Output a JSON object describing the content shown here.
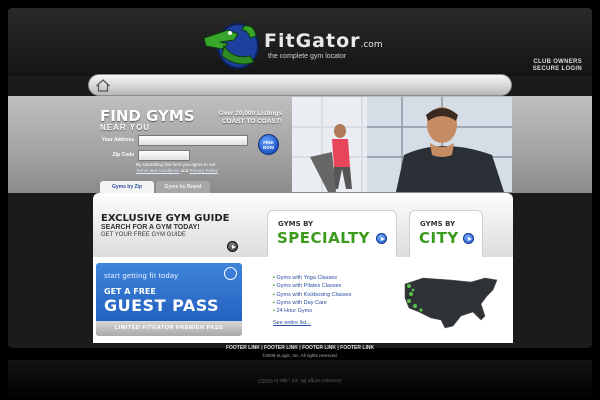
{
  "brand": {
    "name": "FitGator",
    "dotcom": ".com",
    "tagline": "the complete gym locator"
  },
  "header": {
    "club_owners": "CLUB OWNERS",
    "secure_login": "SECURE LOGIN"
  },
  "find": {
    "title": "FIND GYMS",
    "subtitle": "NEAR YOU",
    "listings_line1": "Over 20,000 Listings",
    "listings_line2": "COAST TO COAST!",
    "address_label": "Your Address",
    "address_value": "",
    "zip_label": "Zip Code",
    "zip_value": "",
    "button_line1": "FIND",
    "button_line2": "NOW",
    "disclaimer_pre": "By submitting this form you agree to our",
    "terms_link": "Terms and Conditions",
    "and": "and",
    "privacy_link": "Privacy Policy",
    "tabs": [
      "Gyms by Zip",
      "Gyms by Brand"
    ]
  },
  "exclusive": {
    "title": "EXCLUSIVE GYM GUIDE",
    "line1": "SEARCH FOR A GYM TODAY!",
    "line2": "GET YOUR FREE GYM GUIDE",
    "specialty_small": "GYMS BY",
    "specialty_big": "SPECIALTY",
    "city_small": "GYMS BY",
    "city_big": "CITY"
  },
  "guest_pass": {
    "top": "start getting fit today",
    "get": "GET A FREE",
    "pass": "GUEST PASS",
    "footer": "LIMITED FITGATOR PREMIER PASS"
  },
  "specialty_list": [
    "Gyms with Yoga Classes",
    "Gyms with Pilates Classes",
    "Gyms with Kickboxing Classes",
    "Gyms with Day Care",
    "24 Hour Gyms"
  ],
  "see_entire_list": "See entire list...",
  "footer": {
    "links": [
      "FOOTER LINK",
      "FOOTER LINK",
      "FOOTER LINK",
      "FOOTER LINK"
    ],
    "separator": "|",
    "copyright": "©2009 eLogic, Inc. All rights reserved."
  },
  "colors": {
    "accent_green": "#3a9a1c",
    "accent_blue": "#1f58c9",
    "background": "#000000"
  }
}
